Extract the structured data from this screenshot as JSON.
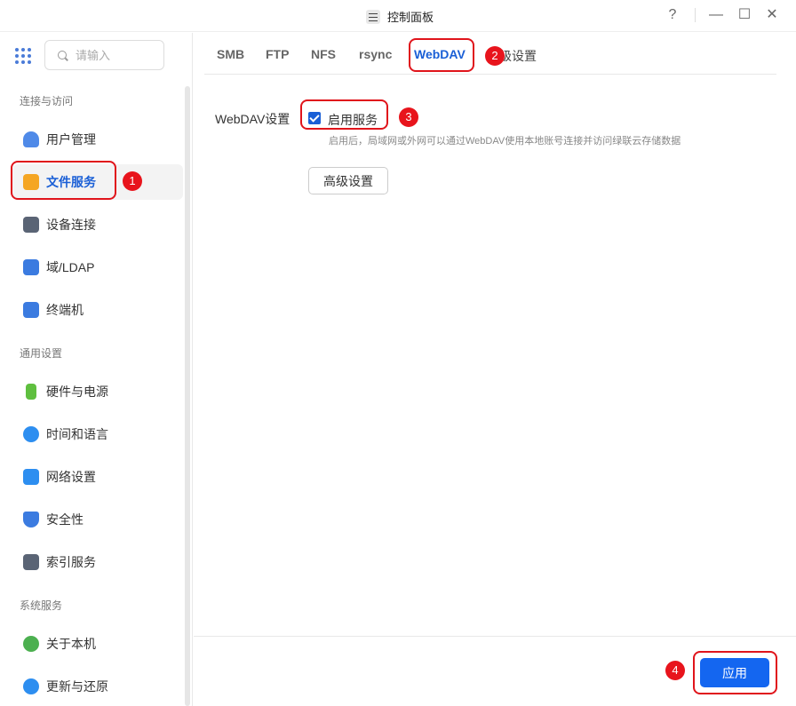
{
  "window": {
    "title": "控制面板",
    "help_glyph": "?",
    "minimize_glyph": "—",
    "maximize_glyph": "☐",
    "close_glyph": "✕"
  },
  "search": {
    "placeholder": "请输入"
  },
  "sidebar": {
    "sections": [
      {
        "label": "连接与访问",
        "items": [
          {
            "label": "用户管理",
            "icon": "user-icon",
            "color": "#4f8ae8"
          },
          {
            "label": "文件服务",
            "icon": "folder-icon",
            "color": "#f5a623",
            "active": true
          },
          {
            "label": "设备连接",
            "icon": "device-icon",
            "color": "#5a6475"
          },
          {
            "label": "域/LDAP",
            "icon": "domain-icon",
            "color": "#3b7be0"
          },
          {
            "label": "终端机",
            "icon": "terminal-icon",
            "color": "#3b7be0"
          }
        ]
      },
      {
        "label": "通用设置",
        "items": [
          {
            "label": "硬件与电源",
            "icon": "battery-icon",
            "color": "#5fbf3f"
          },
          {
            "label": "时间和语言",
            "icon": "globe-icon",
            "color": "#2d8ef0"
          },
          {
            "label": "网络设置",
            "icon": "network-icon",
            "color": "#2d8ef0"
          },
          {
            "label": "安全性",
            "icon": "shield-icon",
            "color": "#3b7be0"
          },
          {
            "label": "索引服务",
            "icon": "index-icon",
            "color": "#5a6475"
          }
        ]
      },
      {
        "label": "系统服务",
        "items": [
          {
            "label": "关于本机",
            "icon": "info-icon",
            "color": "#4cb050"
          },
          {
            "label": "更新与还原",
            "icon": "update-icon",
            "color": "#2d8ef0"
          }
        ]
      }
    ]
  },
  "tabs": [
    {
      "label": "SMB"
    },
    {
      "label": "FTP"
    },
    {
      "label": "NFS"
    },
    {
      "label": "rsync"
    },
    {
      "label": "WebDAV",
      "active": true
    },
    {
      "label": "级设置"
    }
  ],
  "webdav": {
    "field_label": "WebDAV设置",
    "enable_label": "启用服务",
    "enabled": true,
    "hint": "启用后，局域网或外网可以通过WebDAV使用本地账号连接并访问绿联云存储数据",
    "advanced_button": "高级设置"
  },
  "footer": {
    "apply_label": "应用"
  },
  "annotations": {
    "badge1": "1",
    "badge2": "2",
    "badge3": "3",
    "badge4": "4",
    "highlight_color": "#e0141b"
  },
  "colors": {
    "accent": "#1a5fd6",
    "apply": "#1466f0"
  }
}
